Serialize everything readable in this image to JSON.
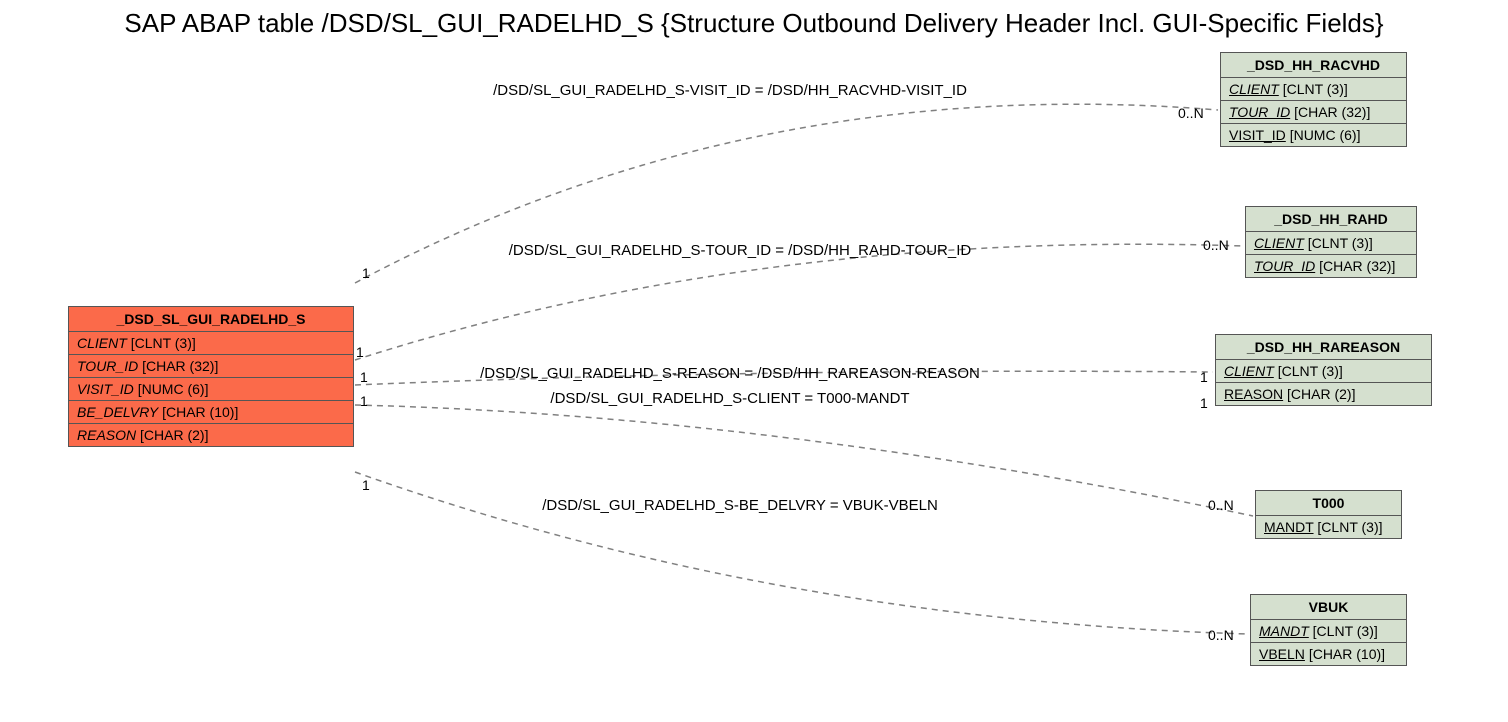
{
  "title": "SAP ABAP table /DSD/SL_GUI_RADELHD_S {Structure Outbound Delivery Header Incl. GUI-Specific Fields}",
  "main": {
    "name": "_DSD_SL_GUI_RADELHD_S",
    "fields": {
      "client": {
        "name": "CLIENT",
        "type": "[CLNT (3)]"
      },
      "tour_id": {
        "name": "TOUR_ID",
        "type": "[CHAR (32)]"
      },
      "visit_id": {
        "name": "VISIT_ID",
        "type": "[NUMC (6)]"
      },
      "be_delvry": {
        "name": "BE_DELVRY",
        "type": "[CHAR (10)]"
      },
      "reason": {
        "name": "REASON",
        "type": "[CHAR (2)]"
      }
    }
  },
  "refs": {
    "racvhd": {
      "name": "_DSD_HH_RACVHD",
      "fields": {
        "client": {
          "name": "CLIENT",
          "type": "[CLNT (3)]"
        },
        "tour_id": {
          "name": "TOUR_ID",
          "type": "[CHAR (32)]"
        },
        "visit_id": {
          "name": "VISIT_ID",
          "type": "[NUMC (6)]"
        }
      }
    },
    "rahd": {
      "name": "_DSD_HH_RAHD",
      "fields": {
        "client": {
          "name": "CLIENT",
          "type": "[CLNT (3)]"
        },
        "tour_id": {
          "name": "TOUR_ID",
          "type": "[CHAR (32)]"
        }
      }
    },
    "rareason": {
      "name": "_DSD_HH_RAREASON",
      "fields": {
        "client": {
          "name": "CLIENT",
          "type": "[CLNT (3)]"
        },
        "reason": {
          "name": "REASON",
          "type": "[CHAR (2)]"
        }
      }
    },
    "t000": {
      "name": "T000",
      "fields": {
        "mandt": {
          "name": "MANDT",
          "type": "[CLNT (3)]"
        }
      }
    },
    "vbuk": {
      "name": "VBUK",
      "fields": {
        "mandt": {
          "name": "MANDT",
          "type": "[CLNT (3)]"
        },
        "vbeln": {
          "name": "VBELN",
          "type": "[CHAR (10)]"
        }
      }
    }
  },
  "edges": {
    "e1": {
      "label": "/DSD/SL_GUI_RADELHD_S-VISIT_ID = /DSD/HH_RACVHD-VISIT_ID",
      "left": "1",
      "right": "0..N"
    },
    "e2": {
      "label": "/DSD/SL_GUI_RADELHD_S-TOUR_ID = /DSD/HH_RAHD-TOUR_ID",
      "left": "1",
      "right": "0..N"
    },
    "e3": {
      "label": "/DSD/SL_GUI_RADELHD_S-REASON = /DSD/HH_RAREASON-REASON",
      "left": "1",
      "right": "1"
    },
    "e4": {
      "label": "/DSD/SL_GUI_RADELHD_S-CLIENT = T000-MANDT",
      "left": "1",
      "right": "1"
    },
    "e5": {
      "label": "/DSD/SL_GUI_RADELHD_S-BE_DELVRY = VBUK-VBELN",
      "left": "1",
      "right": "0..N"
    }
  }
}
